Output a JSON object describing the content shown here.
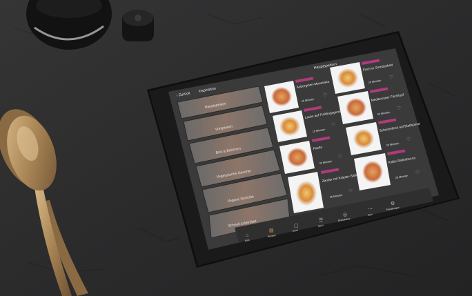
{
  "tablet": {
    "back_label": "Zurück",
    "sidebar_title": "Inspiration",
    "main_title": "Hauptspeisen",
    "categories": [
      {
        "label": "Hauptspeisen"
      },
      {
        "label": "Vorspeisen"
      },
      {
        "label": "Brot & Brötchen"
      },
      {
        "label": "Vegetarische Gerichte"
      },
      {
        "label": "Vegane Gerichte"
      },
      {
        "label": "Schnell zubereitet"
      }
    ],
    "recipes_left": [
      {
        "title": "Auberginen-Moussaka",
        "tag": "HAUPTSPEISEN",
        "time": "45 Minuten"
      },
      {
        "title": "Lachs auf Frühlingsgemüse",
        "tag": "HAUPTSPEISEN",
        "time": "15 Minuten"
      },
      {
        "title": "Paella",
        "tag": "HAUPTSPEISEN",
        "time": "30 Minuten"
      },
      {
        "title": "Zander mit Kräuter-Sahne",
        "tag": "HAUPTSPEISEN",
        "time": "35 Minuten"
      }
    ],
    "recipes_right": [
      {
        "title": "Fisch in Gemüsebett",
        "tag": "HAUPTSPEISEN",
        "time": "20 Minuten"
      },
      {
        "title": "Mediterraner Fischtopf",
        "tag": "HAUPTSPEISEN",
        "time": "30 Minuten"
      },
      {
        "title": "Schnitzelbrot auf Blattspinat",
        "tag": "HAUPTSPEISEN",
        "time": "25 Minuten"
      },
      {
        "title": "Kalbs-Saltimbocca",
        "tag": "HAUPTSPEISEN",
        "time": "35 Minuten"
      }
    ],
    "tabbar": [
      {
        "label": "Start",
        "icon": "home-icon"
      },
      {
        "label": "Rezepte",
        "icon": "book-icon"
      },
      {
        "label": "Gerät",
        "icon": "appliance-icon"
      },
      {
        "label": "Menü",
        "icon": "list-icon"
      },
      {
        "label": "Einkaufsliste",
        "icon": "cart-icon"
      },
      {
        "label": "Mehr",
        "icon": "more-icon"
      },
      {
        "label": "Einstellungen",
        "icon": "gear-icon"
      }
    ]
  },
  "colors": {
    "background": "#2b2b2c",
    "tablet_body": "#121212",
    "screen": "#3a3a3b",
    "accent": "#b03b7a",
    "spoon": "#b28f5f"
  }
}
